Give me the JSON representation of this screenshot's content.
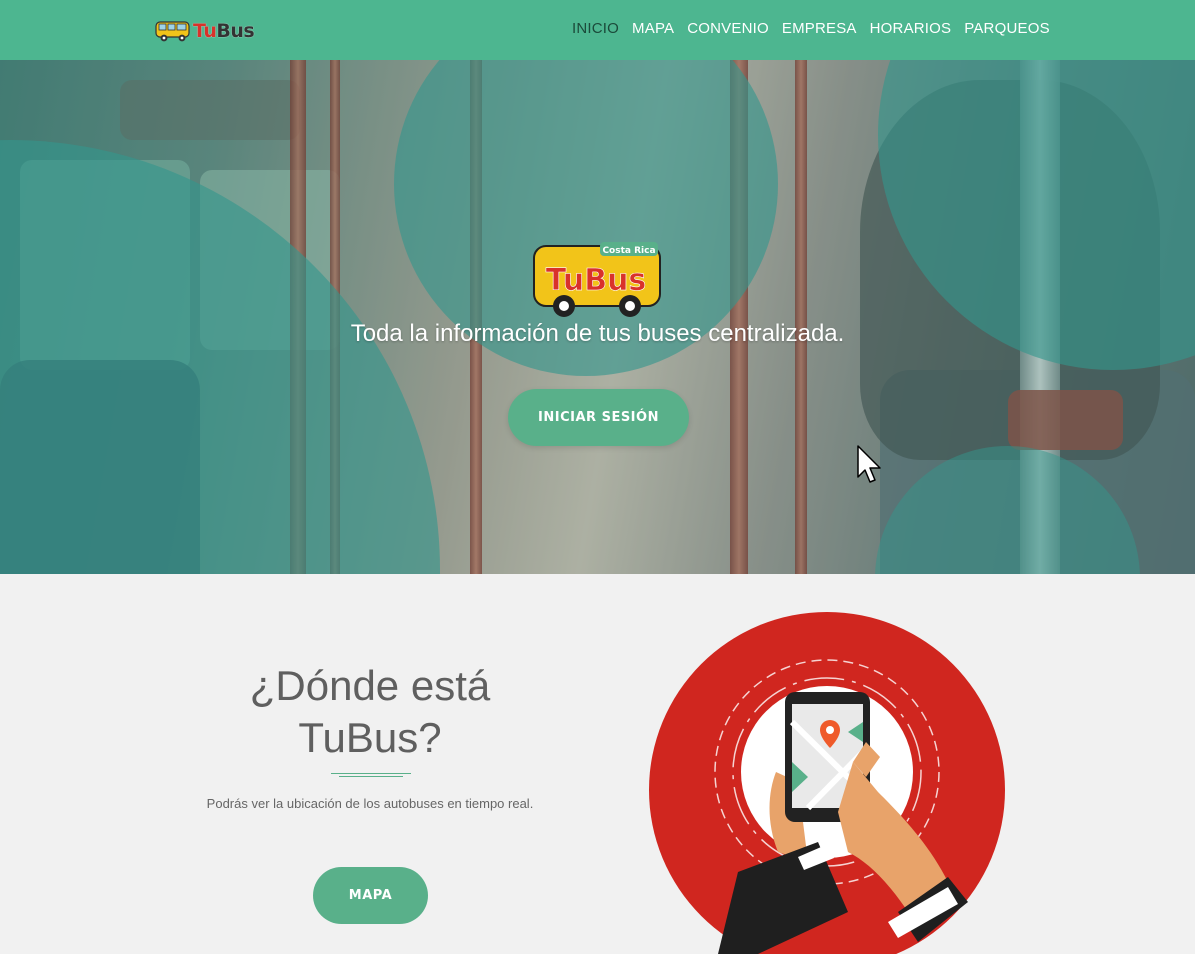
{
  "navbar": {
    "brand": {
      "text_tu": "Tu",
      "text_bus": "Bus"
    },
    "items": [
      {
        "label": "INICIO",
        "active": true
      },
      {
        "label": "MAPA",
        "active": false
      },
      {
        "label": "CONVENIO",
        "active": false
      },
      {
        "label": "EMPRESA",
        "active": false
      },
      {
        "label": "HORARIOS",
        "active": false
      },
      {
        "label": "PARQUEOS",
        "active": false
      }
    ]
  },
  "hero": {
    "logo": {
      "country": "Costa Rica",
      "name": "TuBus"
    },
    "title": "Toda la información de tus buses centralizada.",
    "login_button": "INICIAR SESIÓN"
  },
  "section_map": {
    "title_line1": "¿Dónde está",
    "title_line2": "TuBus?",
    "description": "Podrás ver la ubicación de los autobuses en tiempo real.",
    "button": "MAPA"
  },
  "colors": {
    "accent": "#4db690",
    "button": "#59b08a",
    "illustration_red": "#d0261f",
    "active_nav": "#1b4a3a"
  }
}
